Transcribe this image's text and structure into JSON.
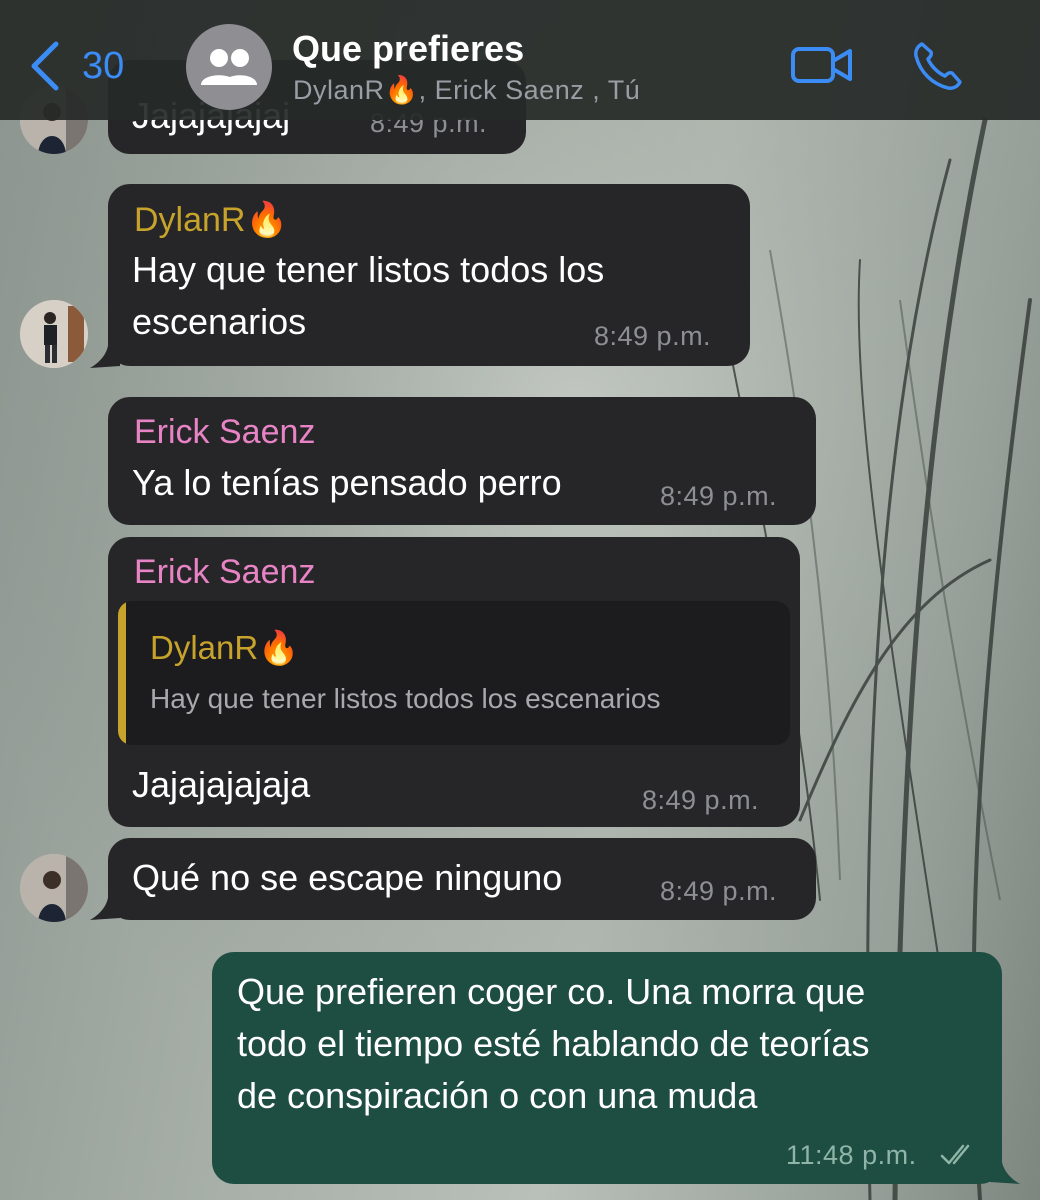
{
  "header": {
    "back_count": "30",
    "title": "Que prefieres",
    "members": "DylanR🔥, Erick Saenz , Tú",
    "icons": {
      "back": "chevron-left-icon",
      "group": "group-avatar-icon",
      "video": "video-camera-icon",
      "call": "phone-icon"
    },
    "accent_color": "#3b8cf5"
  },
  "messages": [
    {
      "sender": "",
      "text": "Jajajajajaj",
      "time": "8:49 p.m."
    },
    {
      "sender": "DylanR🔥",
      "sender_color": "#c8a32c",
      "text_line1": "Hay que tener listos todos los",
      "text_line2": "escenarios",
      "time": "8:49 p.m."
    },
    {
      "sender": "Erick Saenz",
      "sender_color": "#e884c6",
      "text": "Ya lo tenías pensado perro",
      "time": "8:49 p.m."
    },
    {
      "sender": "Erick Saenz",
      "reply_to": {
        "sender": "DylanR🔥",
        "text": "Hay que tener listos todos los escenarios"
      },
      "text": "Jajajajajaja",
      "time": "8:49 p.m."
    },
    {
      "sender": "",
      "text": "Qué no se escape ninguno",
      "time": "8:49 p.m."
    },
    {
      "sender": "Tú",
      "outgoing": true,
      "text_line1": "Que prefieren coger co. Una morra que",
      "text_line2": "todo el tiempo esté hablando de teorías",
      "text_line3": "de conspiración o con una muda",
      "time": "11:48 p.m.",
      "status_icon": "double-check-read-icon"
    }
  ]
}
